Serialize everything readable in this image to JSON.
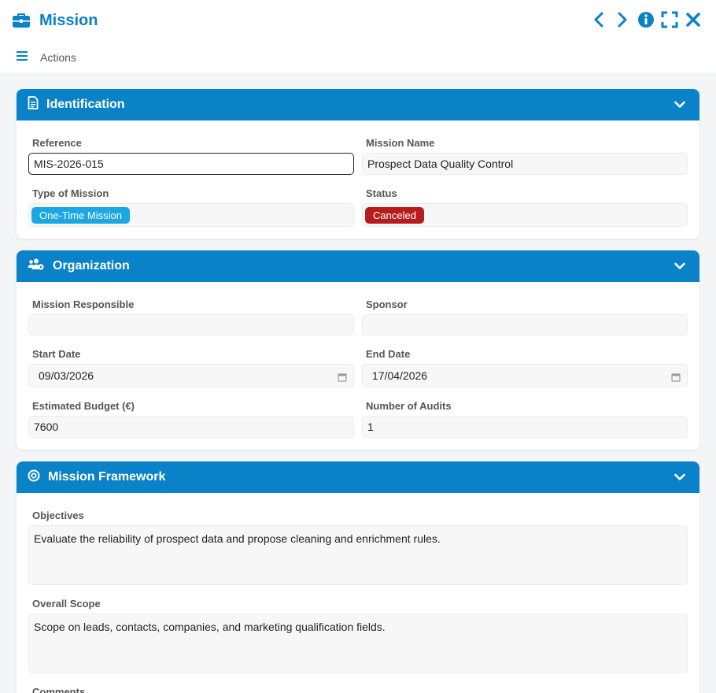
{
  "window": {
    "title": "Mission"
  },
  "toolbar": {
    "actions_label": "Actions"
  },
  "colors": {
    "accent": "#0a82c8",
    "type_pill": "#1aa7e2",
    "status_canceled": "#b71c1c"
  },
  "identification": {
    "title": "Identification",
    "reference_label": "Reference",
    "reference_value": "MIS-2026-015",
    "mission_name_label": "Mission Name",
    "mission_name_value": "Prospect Data Quality Control",
    "type_label": "Type of Mission",
    "type_value": "One-Time Mission",
    "status_label": "Status",
    "status_value": "Canceled"
  },
  "organization": {
    "title": "Organization",
    "responsible_label": "Mission Responsible",
    "responsible_value": "",
    "sponsor_label": "Sponsor",
    "sponsor_value": "",
    "start_label": "Start Date",
    "start_value": "09/03/2026",
    "end_label": "End Date",
    "end_value": "17/04/2026",
    "budget_label": "Estimated Budget (€)",
    "budget_value": "7600",
    "audits_label": "Number of Audits",
    "audits_value": "1"
  },
  "framework": {
    "title": "Mission Framework",
    "objectives_label": "Objectives",
    "objectives_value": "Evaluate the reliability of prospect data and propose cleaning and enrichment rules.",
    "scope_label": "Overall Scope",
    "scope_value": "Scope on leads, contacts, companies, and marketing qualification fields.",
    "comments_label": "Comments"
  }
}
